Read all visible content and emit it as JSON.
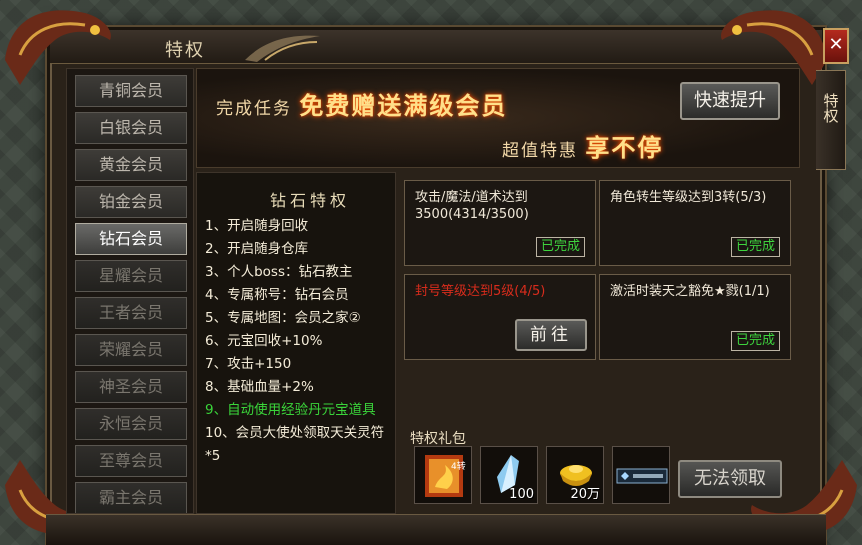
{
  "window": {
    "title": "特权",
    "side_tab": "特权"
  },
  "members": [
    {
      "label": "青铜会员",
      "state": "normal"
    },
    {
      "label": "白银会员",
      "state": "normal"
    },
    {
      "label": "黄金会员",
      "state": "normal"
    },
    {
      "label": "铂金会员",
      "state": "normal"
    },
    {
      "label": "钻石会员",
      "state": "active"
    },
    {
      "label": "星耀会员",
      "state": "dim"
    },
    {
      "label": "王者会员",
      "state": "dim"
    },
    {
      "label": "荣耀会员",
      "state": "dim"
    },
    {
      "label": "神圣会员",
      "state": "dim"
    },
    {
      "label": "永恒会员",
      "state": "dim"
    },
    {
      "label": "至尊会员",
      "state": "dim"
    },
    {
      "label": "霸主会员",
      "state": "dim"
    }
  ],
  "banner": {
    "line1_prefix": "完成任务",
    "line1_highlight": "免费赠送满级会员",
    "line2_prefix": "超值特惠",
    "line2_highlight": "享不停",
    "quick_button": "快速提升"
  },
  "perks": {
    "title": "钻石特权",
    "items": [
      {
        "text": "1、开启随身回收",
        "green": false
      },
      {
        "text": "2、开启随身仓库",
        "green": false
      },
      {
        "text": "3、个人boss：钻石教主",
        "green": false
      },
      {
        "text": "4、专属称号：钻石会员",
        "green": false
      },
      {
        "text": "5、专属地图：会员之家②",
        "green": false
      },
      {
        "text": "6、元宝回收+10%",
        "green": false
      },
      {
        "text": "7、攻击+150",
        "green": false
      },
      {
        "text": "8、基础血量+2%",
        "green": false
      },
      {
        "text": "9、自动使用经验丹元宝道具",
        "green": true
      },
      {
        "text": "10、会员大使处领取天关灵符*5",
        "green": false
      }
    ]
  },
  "tasks": [
    {
      "text": "攻击/魔法/道术达到3500(4314/3500)",
      "status": "已完成"
    },
    {
      "text": "角色转生等级达到3转(5/3)",
      "status": "已完成"
    },
    {
      "text": "封号等级达到5级(4/5)",
      "action": "前往"
    },
    {
      "text": "激活时装天之豁免★戮(1/1)",
      "status": "已完成"
    }
  ],
  "gift": {
    "label": "特权礼包",
    "items": [
      {
        "icon": "fire-scroll-icon",
        "qty": ""
      },
      {
        "icon": "crystal-icon",
        "qty": "100"
      },
      {
        "icon": "gold-ingot-icon",
        "qty": "20万"
      },
      {
        "icon": "diamond-title-icon",
        "qty": ""
      }
    ],
    "claim_button": "无法领取"
  },
  "colors": {
    "complete": "#3ed43e",
    "incomplete_task": "#d82c1c",
    "highlight_text": "#ffe08a",
    "active_tab": "#6a6a68"
  }
}
